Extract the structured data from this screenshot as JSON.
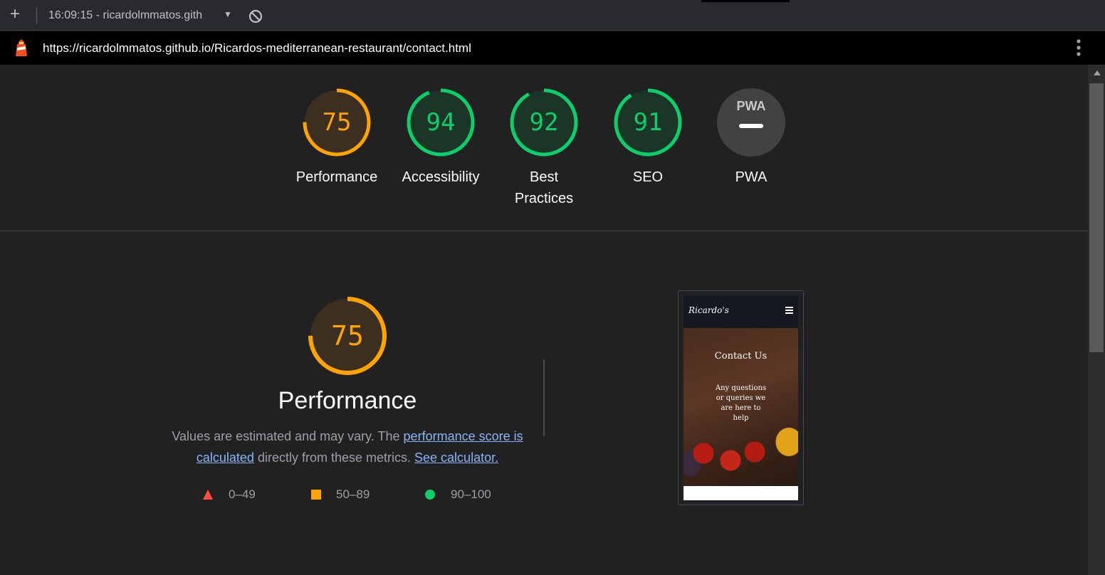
{
  "toolbar": {
    "add_label": "+",
    "session_label": "16:09:15 - ricardolmmatos.gith",
    "dropdown_caret": "▼"
  },
  "urlbar": {
    "url": "https://ricardolmmatos.github.io/Ricardos-mediterranean-restaurant/contact.html"
  },
  "summary_gauges": [
    {
      "label": "Performance",
      "score": "75",
      "fraction": 0.75,
      "color": "#ffa400"
    },
    {
      "label": "Accessibility",
      "score": "94",
      "fraction": 0.94,
      "color": "#0cce6b"
    },
    {
      "label": "Best Practices",
      "score": "92",
      "fraction": 0.92,
      "color": "#0cce6b"
    },
    {
      "label": "SEO",
      "score": "91",
      "fraction": 0.91,
      "color": "#0cce6b"
    },
    {
      "label": "PWA",
      "score": "",
      "fraction": 0,
      "color": "#9aa0a6",
      "badge": "PWA"
    }
  ],
  "performance": {
    "score": "75",
    "fraction": 0.75,
    "title": "Performance",
    "desc_prefix": "Values are estimated and may vary. The ",
    "link_score": "performance score is calculated",
    "desc_middle": " directly from these metrics. ",
    "link_calc": "See calculator.",
    "legend": [
      {
        "range": "0–49",
        "shape": "triangle",
        "color": "#ff4e42"
      },
      {
        "range": "50–89",
        "shape": "square",
        "color": "#ffa400"
      },
      {
        "range": "90–100",
        "shape": "circle",
        "color": "#0cce6b"
      }
    ]
  },
  "screenshot": {
    "brand": "Ricardo's",
    "title": "Contact Us",
    "subtitle": "Any questions or queries we are here to help"
  }
}
